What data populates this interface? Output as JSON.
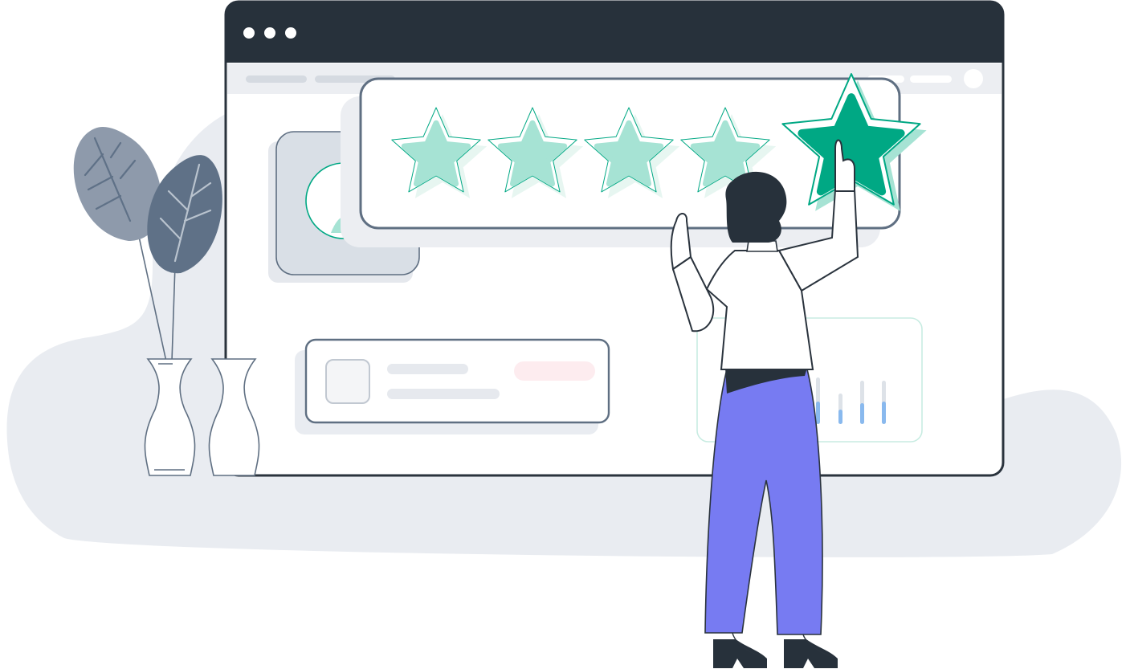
{
  "palette": {
    "background_blob": "#e9ecf1",
    "window_dark": "#27313b",
    "window_frame": "#2a333d",
    "window_body": "#ffffff",
    "toolbar": "#eceef2",
    "toolbar_pill": "#d5dae1",
    "card_stroke": "#5f6f82",
    "card_shadow": "#e5e8ed",
    "star_light": "#a6e3d4",
    "star_dark": "#00a884",
    "star_outline": "#00a884",
    "leaf_light": "#8e9aab",
    "leaf_dark": "#5f7187",
    "pants": "#777bf2",
    "hair": "#27313b",
    "chart_bar_blue": "#89b9ee",
    "chart_bar_gray": "#dde2e8",
    "pink_pill": "#fdecef"
  },
  "window": {
    "controls": [
      "window-dot-icon",
      "window-dot-icon",
      "window-dot-icon"
    ]
  },
  "rating": {
    "max": 5,
    "selected": 5,
    "stars": [
      "star-icon",
      "star-icon",
      "star-icon",
      "star-icon",
      "star-icon"
    ]
  },
  "icons": {
    "plant": "plant-icon",
    "vase": "vase-icon",
    "person": "person-icon",
    "avatar": "avatar-icon",
    "checkbox": "checkbox-icon",
    "chart": "bar-chart-icon"
  }
}
